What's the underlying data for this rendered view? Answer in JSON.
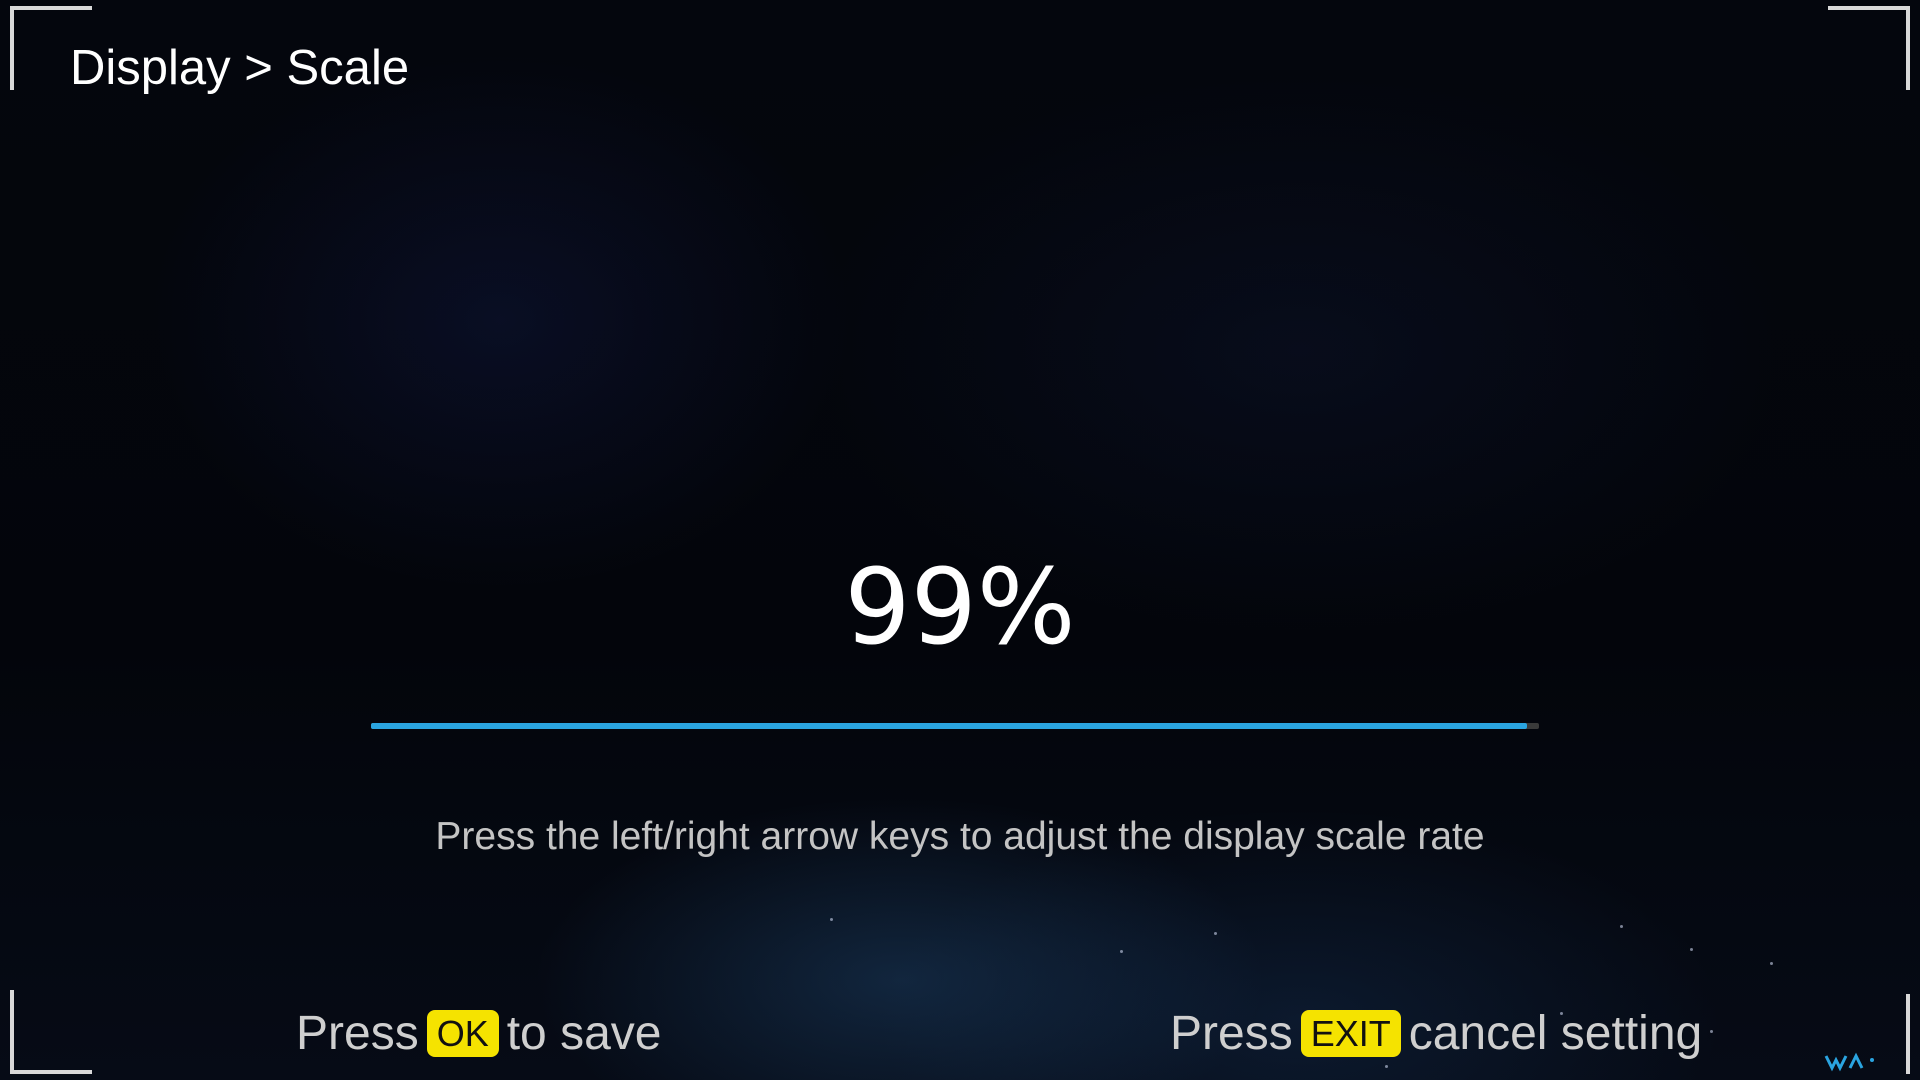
{
  "breadcrumb": "Display > Scale",
  "scale": {
    "value_label": "99%",
    "value_fraction": 0.99
  },
  "hint": "Press the left/right arrow keys to adjust the display scale rate",
  "footer": {
    "save": {
      "prefix": "Press",
      "key": "OK",
      "suffix": "to save"
    },
    "cancel": {
      "prefix": "Press",
      "key": "EXIT",
      "suffix": "cancel setting"
    }
  },
  "colors": {
    "accent": "#2aa4e0",
    "key_badge": "#f5e300",
    "background": "#03050b"
  }
}
